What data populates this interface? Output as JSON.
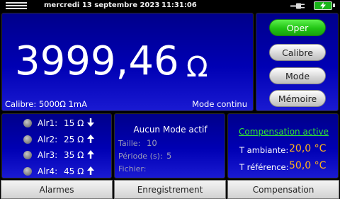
{
  "statusbar": {
    "date": "mercredi 13 septembre 2023",
    "time": "11:31:06",
    "battery_color": "#18b418"
  },
  "display": {
    "reading": "3999,46",
    "unit": "Ω",
    "range": "Calibre: 5000Ω 1mA",
    "mode": "Mode continu"
  },
  "buttons": {
    "oper": "Oper",
    "calibre": "Calibre",
    "mode": "Mode",
    "memoire": "Mémoire"
  },
  "alarms": [
    {
      "label": "Alr1:",
      "value": "15 Ω",
      "direction": "down"
    },
    {
      "label": "Alr2:",
      "value": "25 Ω",
      "direction": "up"
    },
    {
      "label": "Alr3:",
      "value": "35 Ω",
      "direction": "up"
    },
    {
      "label": "Alr4:",
      "value": "45 Ω",
      "direction": "up"
    }
  ],
  "recording": {
    "title": "Aucun Mode actif",
    "size_label": "Taille:",
    "size_value": "10",
    "period_label": "Période (s):",
    "period_value": "5",
    "file_label": "Fichier:"
  },
  "compensation": {
    "title": "Compensation active",
    "ambient_label": "T ambiante:",
    "ambient_value": "20,0 °C",
    "reference_label": "T référence:",
    "reference_value": "50,0 °C"
  },
  "tabs": {
    "alarmes": "Alarmes",
    "enregistrement": "Enregistrement",
    "compensation": "Compensation"
  },
  "colors": {
    "panel": "#0000b4",
    "accent_green": "#21c414",
    "value_orange": "#ffb31a"
  }
}
